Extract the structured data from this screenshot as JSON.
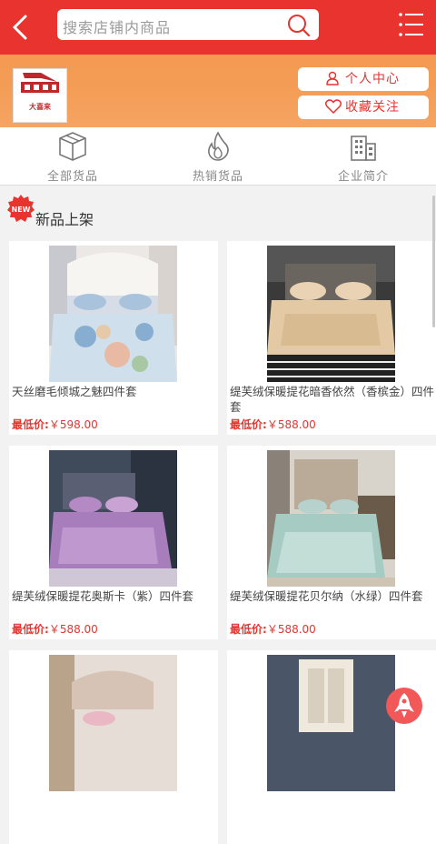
{
  "header": {
    "search_placeholder": "搜索店铺内商品"
  },
  "store": {
    "logo_text": "大喜来",
    "personal_center": "个人中心",
    "follow": "收藏关注"
  },
  "nav": {
    "items": [
      {
        "label": "全部货品",
        "icon": "box-icon"
      },
      {
        "label": "热销货品",
        "icon": "flame-icon"
      },
      {
        "label": "企业简介",
        "icon": "building-icon"
      }
    ]
  },
  "section": {
    "badge": "NEW",
    "title": "新品上架"
  },
  "price_label": "最低价:",
  "products": [
    {
      "name": "天丝磨毛倾城之魅四件套",
      "price": "￥598.00"
    },
    {
      "name": "缇芙绒保暖提花暗香依然（香槟金）四件套",
      "price": "￥588.00"
    },
    {
      "name": "缇芙绒保暖提花奥斯卡（紫）四件套",
      "price": "￥588.00"
    },
    {
      "name": "缇芙绒保暖提花贝尔纳（水绿）四件套",
      "price": "￥588.00"
    }
  ],
  "colors": {
    "brand_red": "#e8332f",
    "store_orange": "#f39c55"
  }
}
